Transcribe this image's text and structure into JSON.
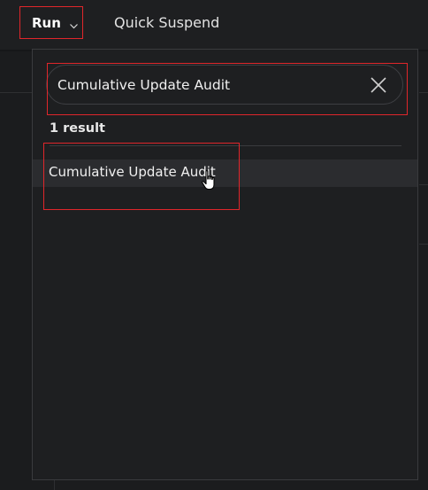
{
  "toolbar": {
    "run_label": "Run",
    "quick_suspend_label": "Quick Suspend",
    "chevron_icon": "chevron-down-icon"
  },
  "search": {
    "value": "Cumulative Update Audit",
    "placeholder": "Search",
    "clear_icon": "close-icon"
  },
  "results": {
    "count_label": "1 result",
    "items": [
      {
        "label": "Cumulative Update Audit"
      }
    ]
  },
  "colors": {
    "background": "#1b1c1e",
    "panel": "#1e1f21",
    "highlight_row": "#2b2c2f",
    "annotation_red": "#e0262b",
    "text": "#f0f0f0"
  }
}
